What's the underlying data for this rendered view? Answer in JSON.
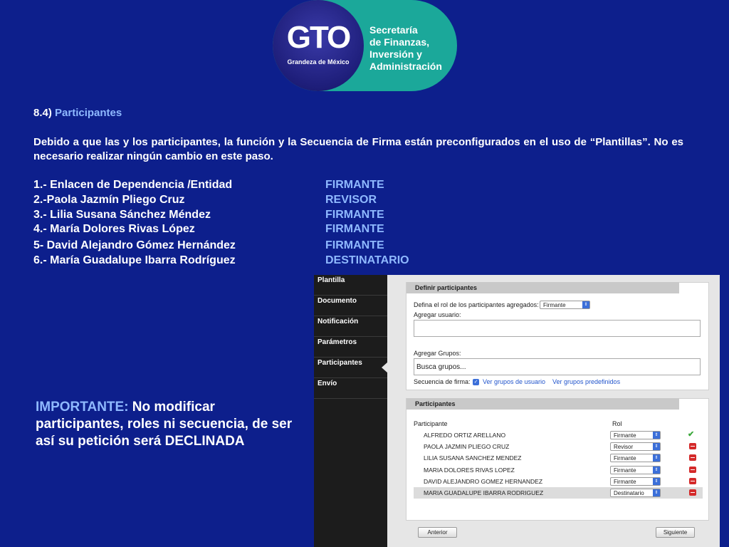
{
  "logo": {
    "brand": "GTO",
    "tagline": "Grandeza de México",
    "org": "Secretaría\nde Finanzas,\nInversión y\nAdministración"
  },
  "section": {
    "number": "8.4)",
    "title": "Participantes"
  },
  "description": "Debido a que las y los participantes, la función y la Secuencia de Firma están preconfigurados en el uso de “Plantillas”. No es necesario realizar ningún cambio en este paso.",
  "participants": [
    {
      "name": "1.- Enlacen de Dependencia /Entidad",
      "role": "FIRMANTE"
    },
    {
      "name": "2.-Paola Jazmín Pliego Cruz",
      "role": "REVISOR"
    },
    {
      "name": "3.- Lilia Susana Sánchez Méndez",
      "role": "FIRMANTE"
    },
    {
      "name": "4.- María Dolores Rivas López",
      "role": "FIRMANTE"
    },
    {
      "name": "5- David Alejandro Gómez Hernández",
      "role": "FIRMANTE"
    },
    {
      "name": "6.- María Guadalupe Ibarra Rodríguez",
      "role": "DESTINATARIO"
    }
  ],
  "important": {
    "keyword": "IMPORTANTE:",
    "text": " No modificar participantes, roles ni secuencia, de ser así su petición será DECLINADA"
  },
  "screenshot": {
    "sidebar": [
      "Plantilla",
      "Documento",
      "Notificación",
      "Parámetros",
      "Participantes",
      "Envío"
    ],
    "active_sidebar": "Participantes",
    "define_panel": {
      "title": "Definir participantes",
      "role_label": "Defina el rol de los participantes agregados:",
      "role_value": "Firmante",
      "user_label": "Agregar usuario:",
      "user_value": "",
      "groups_label": "Agregar Grupos:",
      "groups_placeholder": "Busca grupos...",
      "sequence_label": "Secuencia de firma:",
      "link_user_groups": "Ver grupos de usuario",
      "link_predefined": "Ver grupos predefinidos"
    },
    "participants_panel": {
      "title": "Participantes",
      "col_participant": "Participante",
      "col_role": "Rol",
      "rows": [
        {
          "name": "ALFREDO ORTIZ ARELLANO",
          "role": "Firmante",
          "status": "check"
        },
        {
          "name": "PAOLA JAZMIN PLIEGO CRUZ",
          "role": "Revisor",
          "status": "remove"
        },
        {
          "name": "LILIA SUSANA SANCHEZ MENDEZ",
          "role": "Firmante",
          "status": "remove"
        },
        {
          "name": "MARIA DOLORES RIVAS LOPEZ",
          "role": "Firmante",
          "status": "remove"
        },
        {
          "name": "DAVID ALEJANDRO GOMEZ HERNANDEZ",
          "role": "Firmante",
          "status": "remove"
        },
        {
          "name": "MARIA GUADALUPE IBARRA RODRIGUEZ",
          "role": "Destinatario",
          "status": "remove"
        }
      ]
    },
    "btn_prev": "Anterior",
    "btn_next": "Siguiente"
  }
}
